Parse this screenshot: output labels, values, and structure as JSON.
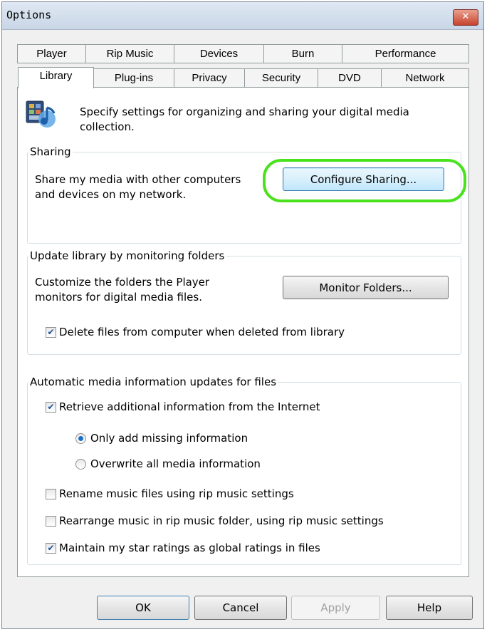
{
  "window": {
    "title": "Options",
    "close_symbol": "✕"
  },
  "tabs": {
    "row1": [
      "Player",
      "Rip Music",
      "Devices",
      "Burn",
      "Performance"
    ],
    "row2": [
      "Library",
      "Plug-ins",
      "Privacy",
      "Security",
      "DVD",
      "Network"
    ],
    "selected": "Library"
  },
  "header": {
    "text": "Specify settings for organizing and sharing your digital media collection."
  },
  "sharing": {
    "legend": "Sharing",
    "description": "Share my media with other computers and devices on my network.",
    "button": "Configure Sharing..."
  },
  "monitor": {
    "legend": "Update library by monitoring folders",
    "description": "Customize the folders the Player monitors for digital media files.",
    "button": "Monitor Folders...",
    "delete_checkbox": {
      "label": "Delete files from computer when deleted from library",
      "checked": true
    }
  },
  "auto_update": {
    "legend": "Automatic media information updates for files",
    "retrieve": {
      "label": "Retrieve additional information from the Internet",
      "checked": true
    },
    "radio_missing": {
      "label": "Only add missing information",
      "selected": true
    },
    "radio_overwrite": {
      "label": "Overwrite all media information",
      "selected": false
    },
    "rename": {
      "label": "Rename music files using rip music settings",
      "checked": false
    },
    "rearrange": {
      "label": "Rearrange music in rip music folder, using rip music settings",
      "checked": false
    },
    "maintain": {
      "label": "Maintain my star ratings as global ratings in files",
      "checked": true
    }
  },
  "buttons": {
    "ok": "OK",
    "cancel": "Cancel",
    "apply": "Apply",
    "help": "Help"
  },
  "colors": {
    "highlight": "#4ae21e",
    "focus_border": "#3c7fb1",
    "check": "#1c4f9c"
  },
  "icons": {
    "header": "media-library-icon",
    "check_mark": "✔"
  }
}
